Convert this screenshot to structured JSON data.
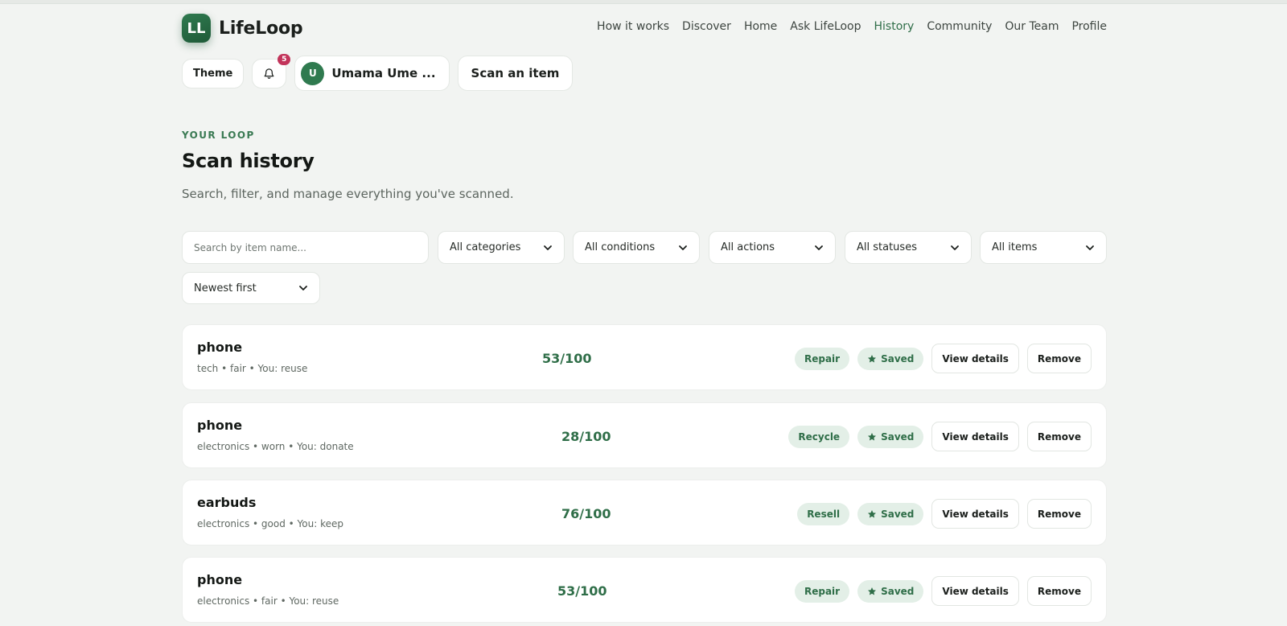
{
  "app": {
    "logo_mark": "LL",
    "name": "LifeLoop"
  },
  "nav": [
    {
      "label": "How it works",
      "active": false
    },
    {
      "label": "Discover",
      "active": false
    },
    {
      "label": "Home",
      "active": false
    },
    {
      "label": "Ask LifeLoop",
      "active": false
    },
    {
      "label": "History",
      "active": true
    },
    {
      "label": "Community",
      "active": false
    },
    {
      "label": "Our Team",
      "active": false
    },
    {
      "label": "Profile",
      "active": false
    }
  ],
  "controls": {
    "theme_label": "Theme",
    "notifications_count": "5",
    "user_initial": "U",
    "user_name": "Umama Ume ...",
    "scan_label": "Scan an item"
  },
  "page": {
    "eyebrow": "YOUR LOOP",
    "title": "Scan history",
    "subtitle": "Search, filter, and manage everything you've scanned."
  },
  "filters": {
    "search_placeholder": "Search by item name...",
    "category": "All categories",
    "condition": "All conditions",
    "action": "All actions",
    "status": "All statuses",
    "items": "All items",
    "sort": "Newest first"
  },
  "rows": [
    {
      "name": "phone",
      "meta": "tech • fair • You: reuse",
      "score": "53/100",
      "action": "Repair",
      "status": "Saved",
      "view_label": "View details",
      "remove_label": "Remove"
    },
    {
      "name": "phone",
      "meta": "electronics • worn • You: donate",
      "score": "28/100",
      "action": "Recycle",
      "status": "Saved",
      "view_label": "View details",
      "remove_label": "Remove"
    },
    {
      "name": "earbuds",
      "meta": "electronics • good • You: keep",
      "score": "76/100",
      "action": "Resell",
      "status": "Saved",
      "view_label": "View details",
      "remove_label": "Remove"
    },
    {
      "name": "phone",
      "meta": "electronics • fair • You: reuse",
      "score": "53/100",
      "action": "Repair",
      "status": "Saved",
      "view_label": "View details",
      "remove_label": "Remove"
    }
  ],
  "colors": {
    "accent": "#2f6e48",
    "background": "#f2f4f2",
    "badge": "#c2345a"
  }
}
